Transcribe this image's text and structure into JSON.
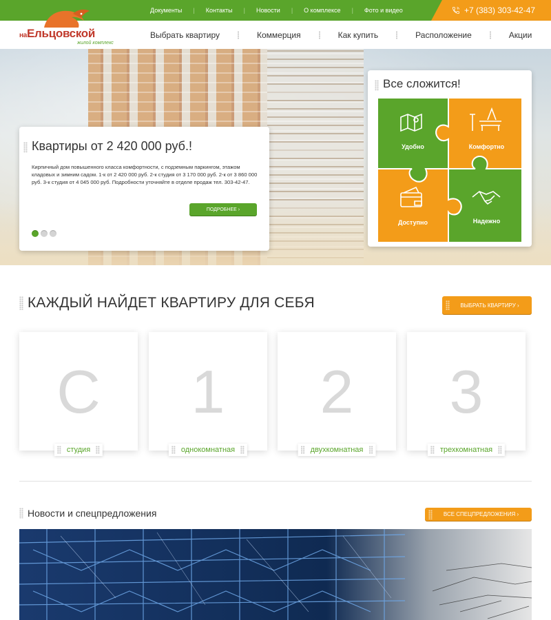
{
  "topbar": {
    "links": [
      "Документы",
      "Контакты",
      "Новости",
      "О комплексе",
      "Фото и видео"
    ],
    "phone": "+7 (383) 303-42-47",
    "colors": {
      "green": "#5aa52b",
      "orange": "#f39c19"
    }
  },
  "logo": {
    "prefix": "на",
    "name": "Ельцовской",
    "sub": "жилой комплекс"
  },
  "nav": {
    "items": [
      "Выбрать квартиру",
      "Коммерция",
      "Как купить",
      "Расположение",
      "Акции"
    ]
  },
  "hero": {
    "title": "Квартиры от 2 420 000 руб.!",
    "text": "Кирпичный дом повышенного класса комфортности, с подземным паркингом, этажом кладовых и зимним садом. 1-к от 2 420 000 руб. 2-к студия от 3 170 000 руб. 2-к от 3 860 000 руб. 3-к студия от 4 045 000 руб. Подробности уточняйте в отделе продаж тел. 303-42-47.",
    "button": "ПОДРОБНЕЕ ›",
    "slides": 3,
    "active_slide": 1
  },
  "features": {
    "title": "Все сложится!",
    "tiles": [
      {
        "label": "Удобно",
        "icon": "map-icon",
        "color": "#5aa52b"
      },
      {
        "label": "Комфортно",
        "icon": "bench-icon",
        "color": "#f39c19"
      },
      {
        "label": "Доступно",
        "icon": "wallet-icon",
        "color": "#f39c19"
      },
      {
        "label": "Надежно",
        "icon": "handshake-icon",
        "color": "#5aa52b"
      }
    ]
  },
  "apartments": {
    "title": "КАЖДЫЙ НАЙДЕТ КВАРТИРУ ДЛЯ СЕБЯ",
    "button": "ВЫБРАТЬ КВАРТИРУ ›",
    "cards": [
      {
        "num": "С",
        "label": "студия"
      },
      {
        "num": "1",
        "label": "однокомнатная"
      },
      {
        "num": "2",
        "label": "двухкомнатная"
      },
      {
        "num": "3",
        "label": "трехкомнатная"
      }
    ]
  },
  "news": {
    "title": "Новости и спецпредложения",
    "button": "ВСЕ СПЕЦПРЕДЛОЖЕНИЯ ›"
  }
}
